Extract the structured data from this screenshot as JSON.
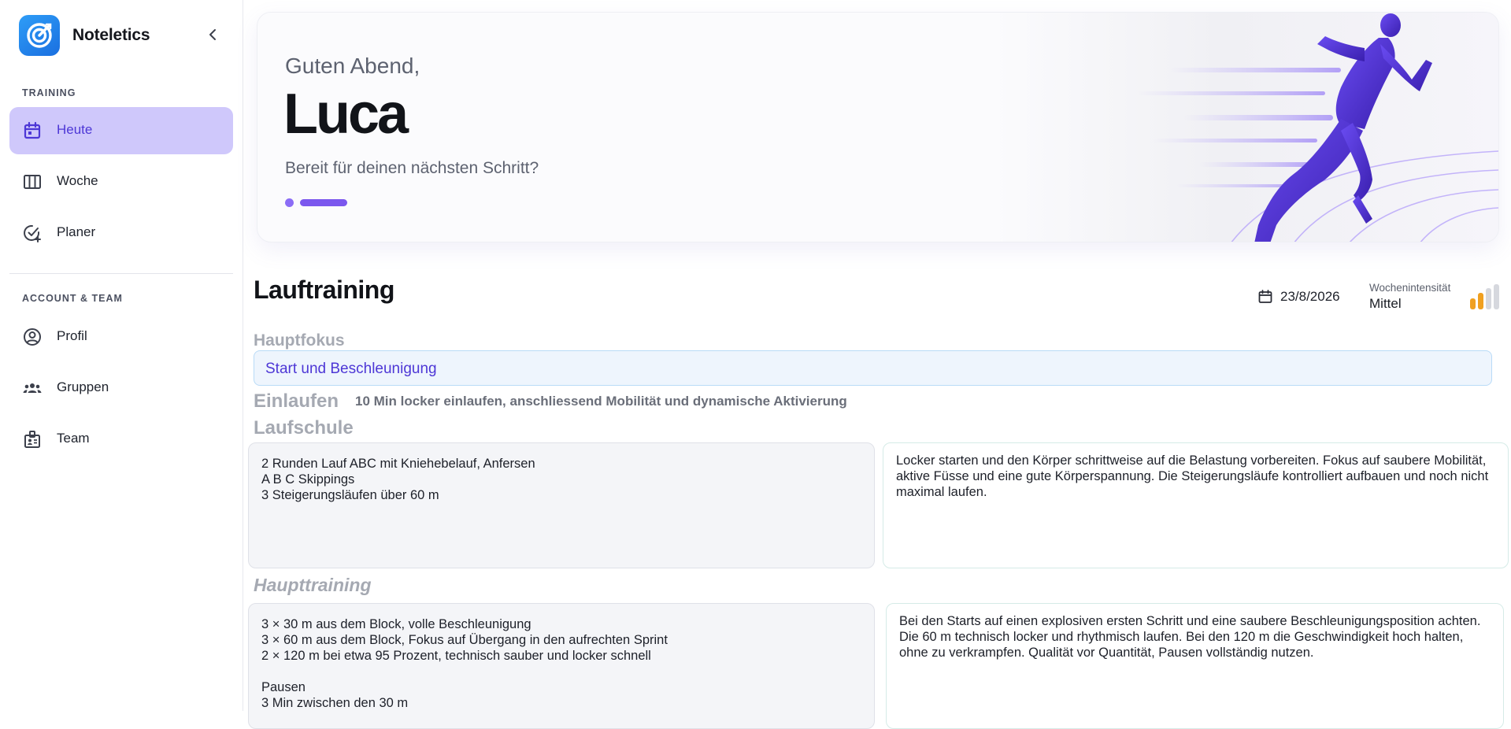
{
  "app": {
    "name": "Noteletics"
  },
  "colors": {
    "accent": "#4d37d6",
    "active_bg": "#cfc8fb",
    "intensity_on": "#f0a020",
    "intensity_off": "#d6d8de"
  },
  "sidebar": {
    "sections": [
      {
        "label": "TRAINING"
      },
      {
        "label": "ACCOUNT & TEAM"
      }
    ],
    "items": [
      {
        "label": "Heute",
        "icon": "calendar-icon",
        "active": true
      },
      {
        "label": "Woche",
        "icon": "week-columns-icon",
        "active": false
      },
      {
        "label": "Planer",
        "icon": "calendar-check-icon",
        "active": false
      },
      {
        "label": "Profil",
        "icon": "user-circle-icon",
        "active": false
      },
      {
        "label": "Gruppen",
        "icon": "group-icon",
        "active": false
      },
      {
        "label": "Team",
        "icon": "id-badge-icon",
        "active": false
      }
    ]
  },
  "hero": {
    "greeting": "Guten Abend,",
    "name": "Luca",
    "subtitle": "Bereit für deinen nächsten Schritt?"
  },
  "training": {
    "title": "Lauftraining",
    "date": "23/8/2026",
    "intensity_label": "Wochenintensität",
    "intensity_value": "Mittel",
    "intensity_level": 2,
    "intensity_max": 4,
    "focus_label": "Hauptfokus",
    "focus_value": "Start und Beschleunigung",
    "warmup_label": "Einlaufen",
    "warmup_text": "10 Min locker einlaufen, anschliessend Mobilität und dynamische Aktivierung",
    "school_label": "Laufschule",
    "school_exercises": "2 Runden Lauf ABC mit Kniehebelauf, Anfersen\nA B C Skippings\n3 Steigerungsläufen über 60 m",
    "school_notes": "Locker starten und den Körper schrittweise auf die Belastung vorbereiten. Fokus auf saubere Mobilität, aktive Füsse und eine gute Körperspannung. Die Steigerungsläufe kontrolliert aufbauen und noch nicht maximal laufen.",
    "main_label": "Haupttraining",
    "main_exercises": "3 × 30 m aus dem Block, volle Beschleunigung\n3 × 60 m aus dem Block, Fokus auf Übergang in den aufrechten Sprint\n2 × 120 m bei etwa 95 Prozent, technisch sauber und locker schnell\n\nPausen\n3 Min zwischen den 30 m",
    "main_notes": "Bei den Starts auf einen explosiven ersten Schritt und eine saubere Beschleunigungsposition achten. Die 60 m technisch locker und rhythmisch laufen. Bei den 120 m die Geschwindigkeit hoch halten, ohne zu verkrampfen. Qualität vor Quantität, Pausen vollständig nutzen."
  }
}
